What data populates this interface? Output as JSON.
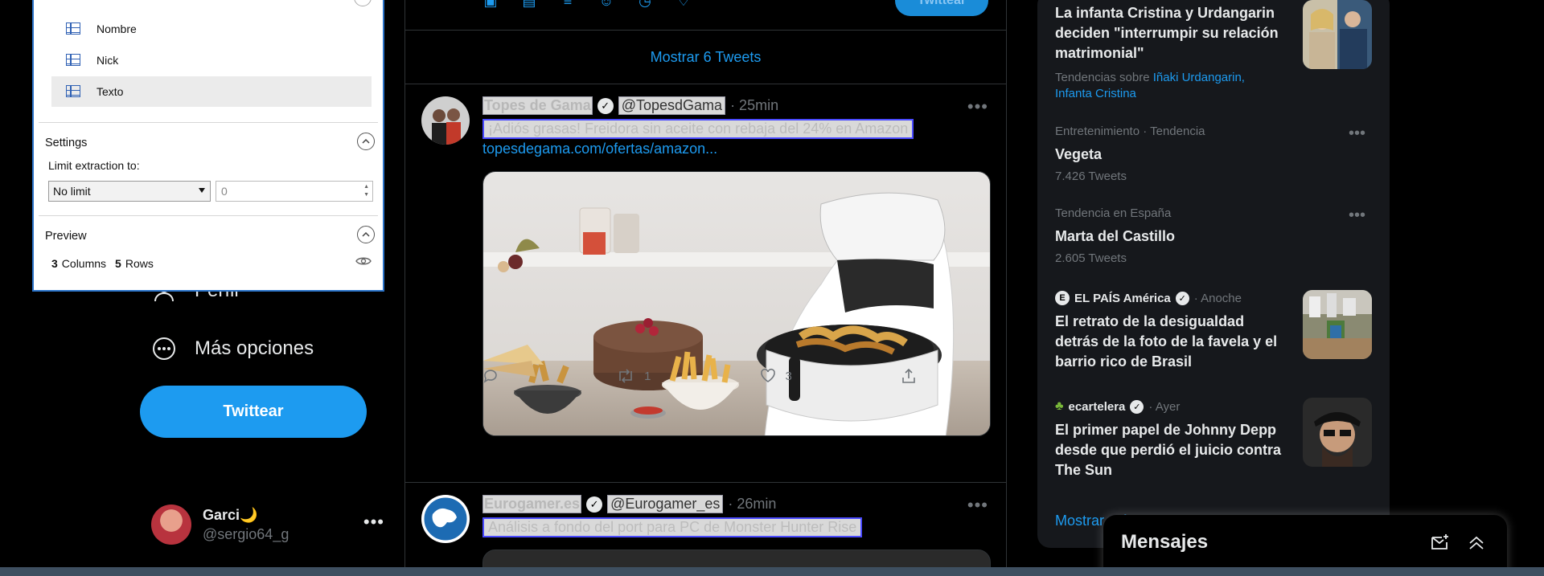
{
  "panel": {
    "fields": [
      {
        "label": "Nombre"
      },
      {
        "label": "Nick"
      },
      {
        "label": "Texto"
      }
    ],
    "settings_title": "Settings",
    "limit_label": "Limit extraction to:",
    "limit_select": "No limit",
    "limit_value": "0",
    "preview_title": "Preview",
    "columns_count": "3",
    "columns_label": "Columns",
    "rows_count": "5",
    "rows_label": "Rows"
  },
  "leftnav": {
    "profile_label": "Perfil",
    "more_label": "Más opciones",
    "tweet_button": "Twittear",
    "account_name": "Garci🌙",
    "account_handle": "@sergio64_g"
  },
  "timeline": {
    "compose_button": "Twittear",
    "show_new": "Mostrar 6 Tweets",
    "tweets": [
      {
        "name": "Topes de Gama",
        "handle": "@TopesdGama",
        "time": "· 25min",
        "text": "¡Adiós grasas! Freidora sin aceite con rebaja del 24% en Amazon",
        "link": "topesdegama.com/ofertas/amazon...",
        "replies": "",
        "retweets": "1",
        "likes": "3"
      },
      {
        "name": "Eurogamer.es",
        "handle": "@Eurogamer_es",
        "time": "· 26min",
        "text": "Análisis a fondo del port para PC de Monster Hunter Rise"
      }
    ]
  },
  "trends": {
    "items": [
      {
        "title": "La infanta Cristina y Urdangarin deciden \"interrumpir su relación matrimonial\"",
        "sub_prefix": "Tendencias sobre",
        "sub_link1": "Iñaki Urdangarin,",
        "sub_link2": "Infanta Cristina"
      },
      {
        "meta": "Entretenimiento · Tendencia",
        "title": "Vegeta",
        "sub": "7.426 Tweets"
      },
      {
        "meta": "Tendencia en España",
        "title": "Marta del Castillo",
        "sub": "2.605 Tweets"
      },
      {
        "source": "EL PAÍS América",
        "when": "· Anoche",
        "title": "El retrato de la desigualdad detrás de la foto de la favela y el barrio rico de Brasil"
      },
      {
        "source": "ecartelera",
        "when": "· Ayer",
        "title": "El primer papel de Johnny Depp desde que perdió el juicio contra The Sun"
      }
    ],
    "show_more": "Mostrar más"
  },
  "messages": {
    "title": "Mensajes"
  },
  "colors": {
    "accent": "#1d9bf0",
    "panel_border": "#2a72c8",
    "background": "#000000",
    "card": "#16181c"
  }
}
